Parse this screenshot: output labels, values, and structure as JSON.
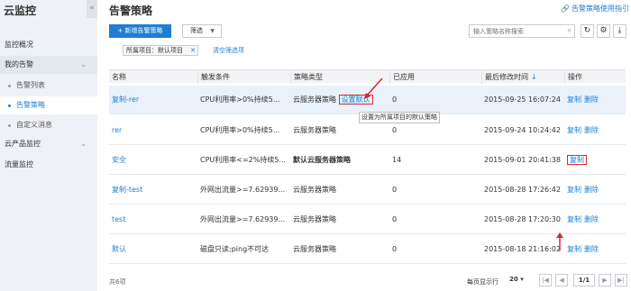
{
  "sidebar": {
    "title": "云监控",
    "collapse_glyph": "«",
    "items": [
      {
        "label": "监控概况"
      },
      {
        "label": "我的告警"
      },
      {
        "label": "告警列表"
      },
      {
        "label": "告警策略"
      },
      {
        "label": "自定义消息"
      },
      {
        "label": "云产品监控"
      },
      {
        "label": "流量监控"
      }
    ]
  },
  "header": {
    "title": "告警策略",
    "help_link": "告警策略使用指引"
  },
  "toolbar": {
    "new_button": "+ 新增告警策略",
    "filter_button": "筛选",
    "search_placeholder": "输入策略名称搜索",
    "search_value": ""
  },
  "filter": {
    "chip_label": "所属项目：默认项目",
    "clear_label": "清空筛选项"
  },
  "table": {
    "columns": [
      "名称",
      "触发条件",
      "策略类型",
      "已应用",
      "最后修改时间",
      "操作"
    ],
    "sort_glyph": "↓",
    "rows": [
      {
        "name": "复制-rer",
        "condition": "CPU利用率>0%持续5...",
        "type": "云服务器策略",
        "set_default": "设置默认",
        "applied": "0",
        "time": "2015-09-25 16:07:24",
        "copy": "复制",
        "delete": "删除"
      },
      {
        "name": "rer",
        "condition": "CPU利用率>0%持续5...",
        "type": "云服务器策略",
        "applied": "0",
        "time": "2015-09-24 10:24:42",
        "copy": "复制",
        "delete": "删除"
      },
      {
        "name": "安全",
        "condition": "CPU利用率<=2%持续5...",
        "type": "默认云服务器策略",
        "applied": "14",
        "time": "2015-09-01 20:41:38",
        "copy": "复制"
      },
      {
        "name": "复制-test",
        "condition": "外网出流量>=7.62939...",
        "type": "云服务器策略",
        "applied": "0",
        "time": "2015-08-28 17:26:42",
        "copy": "复制",
        "delete": "删除"
      },
      {
        "name": "test",
        "condition": "外网出流量>=7.62939...",
        "type": "云服务器策略",
        "applied": "0",
        "time": "2015-08-28 17:20:30",
        "copy": "复制",
        "delete": "删除"
      },
      {
        "name": "默认",
        "condition": "磁盘只读;ping不可达",
        "type": "云服务器策略",
        "applied": "0",
        "time": "2015-08-18 21:16:02",
        "copy": "复制",
        "delete": "删除"
      }
    ]
  },
  "tooltip": "设置为所属项目的默认策略",
  "footer": {
    "total": "共6项",
    "per_page_label": "每页显示行",
    "per_page_value": "20",
    "page": "1/1"
  },
  "colors": {
    "accent": "#1f7ed3",
    "highlight_row": "#e9f2fb",
    "annotation_red": "#d9282f"
  }
}
